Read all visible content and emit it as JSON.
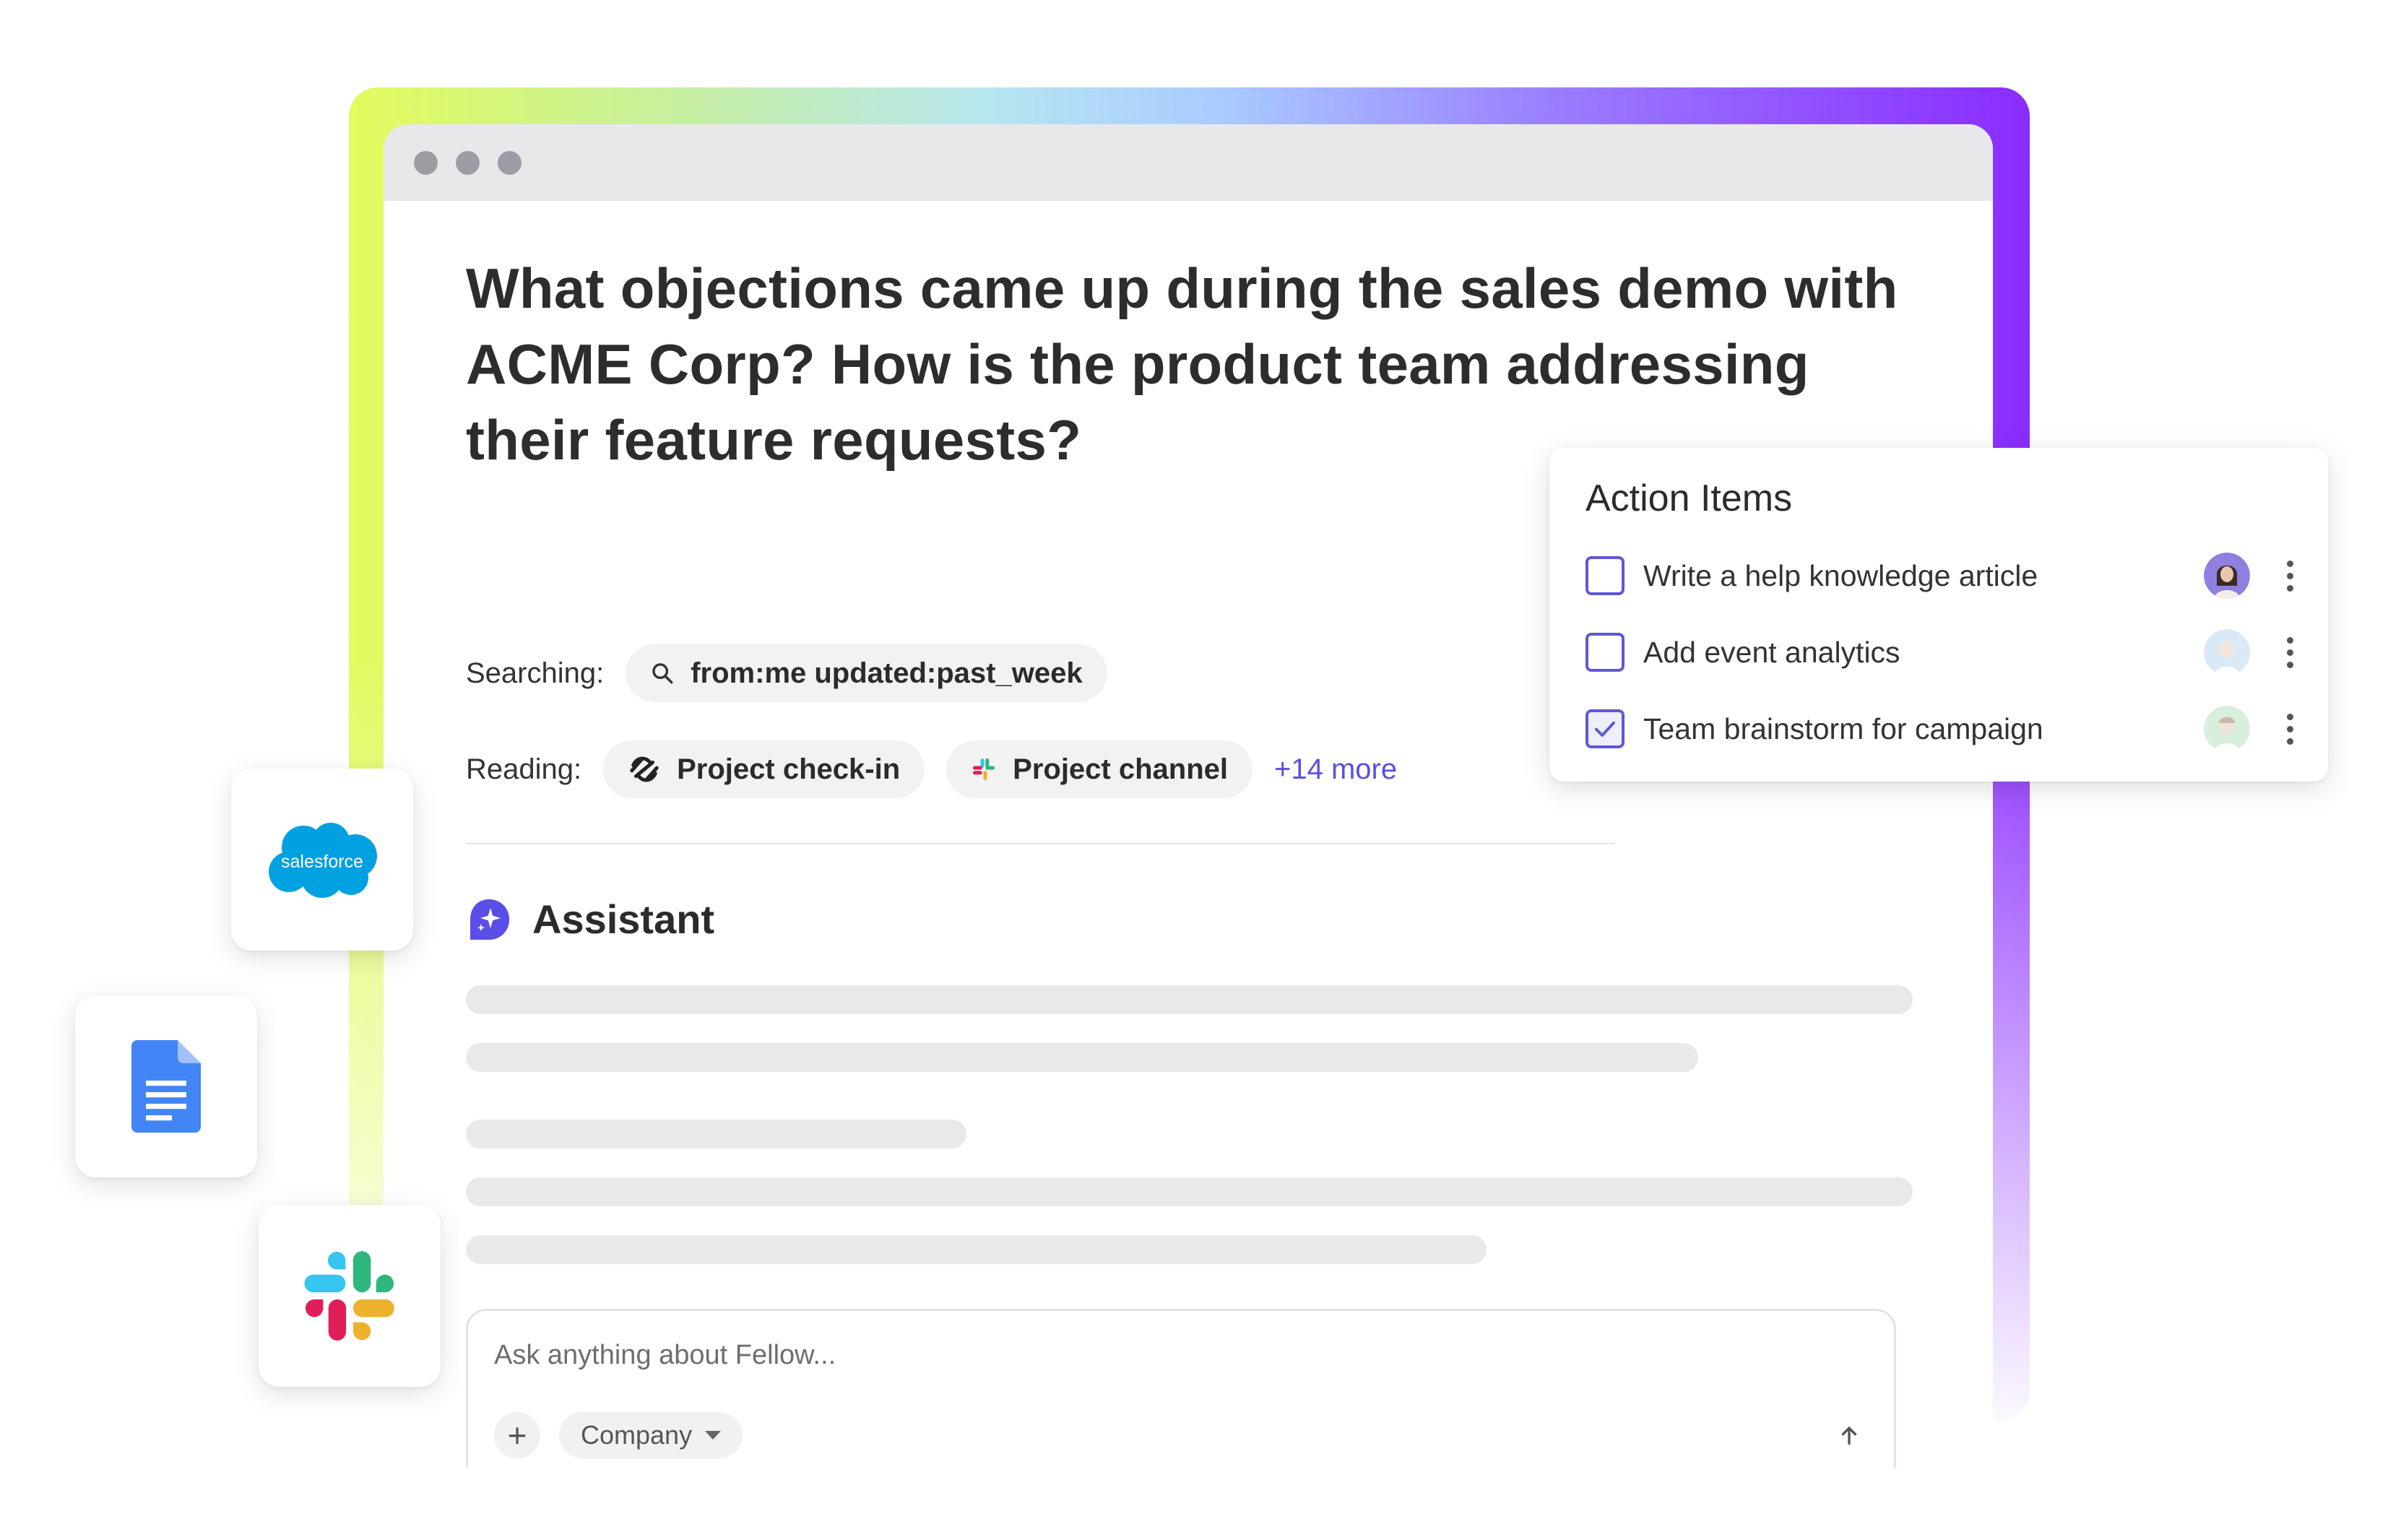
{
  "window": {
    "question": "What objections came up during the sales demo with ACME Corp? How is the product team addressing their feature requests?"
  },
  "searching": {
    "label": "Searching:",
    "query": "from:me updated:past_week"
  },
  "reading": {
    "label": "Reading:",
    "sources": [
      {
        "label": "Project check-in",
        "icon": "fellow-logo-icon"
      },
      {
        "label": "Project channel",
        "icon": "slack-icon"
      }
    ],
    "more": "+14 more"
  },
  "assistant": {
    "title": "Assistant",
    "icon": "assistant-sparkle-icon",
    "accent": "#5b4ee6"
  },
  "composer": {
    "placeholder": "Ask anything about Fellow...",
    "add": "+",
    "scope": "Company"
  },
  "badges": {
    "salesforce": "salesforce",
    "docs": "google-docs-icon",
    "slack": "slack-icon"
  },
  "action_items": {
    "title": "Action Items",
    "items": [
      {
        "label": "Write a help knowledge article",
        "checked": false
      },
      {
        "label": "Add event analytics",
        "checked": false
      },
      {
        "label": "Team brainstorm for campaign",
        "checked": true
      }
    ]
  },
  "colors": {
    "checkbox": "#5f58d6",
    "link": "#5a4fe0",
    "salesforce_blue": "#00a1e0",
    "docs_blue": "#4285f4"
  }
}
